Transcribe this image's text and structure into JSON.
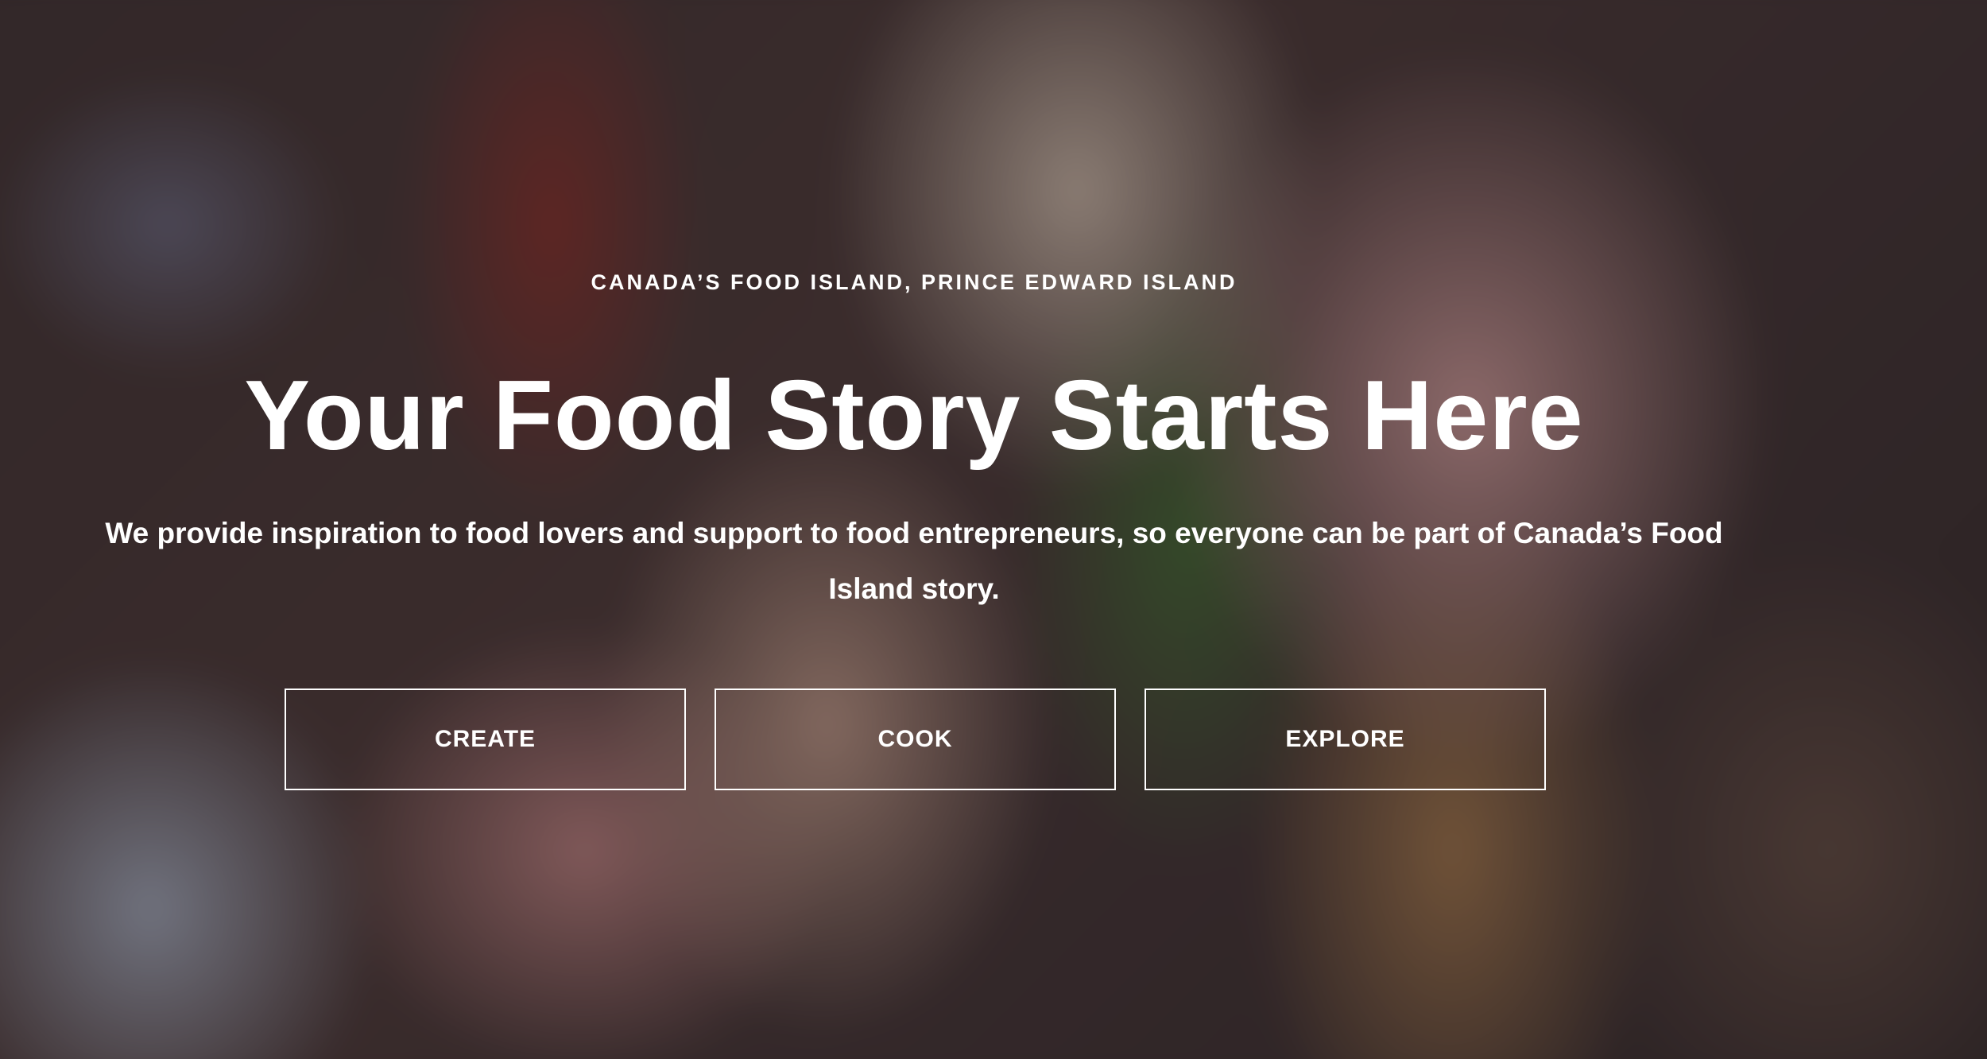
{
  "hero": {
    "eyebrow": "CANADA’S FOOD ISLAND, PRINCE EDWARD ISLAND",
    "headline": "Your Food Story Starts Here",
    "subtext": "We provide inspiration to food lovers and support to food entrepreneurs, so everyone can be part of Canada’s Food Island story.",
    "background_image": "blurred-photo-hands-holding-sandwich"
  },
  "buttons": [
    {
      "label": "CREATE"
    },
    {
      "label": "COOK"
    },
    {
      "label": "EXPLORE"
    }
  ],
  "colors": {
    "text": "#ffffff",
    "button_border": "#ffffff",
    "overlay": "#282228"
  }
}
